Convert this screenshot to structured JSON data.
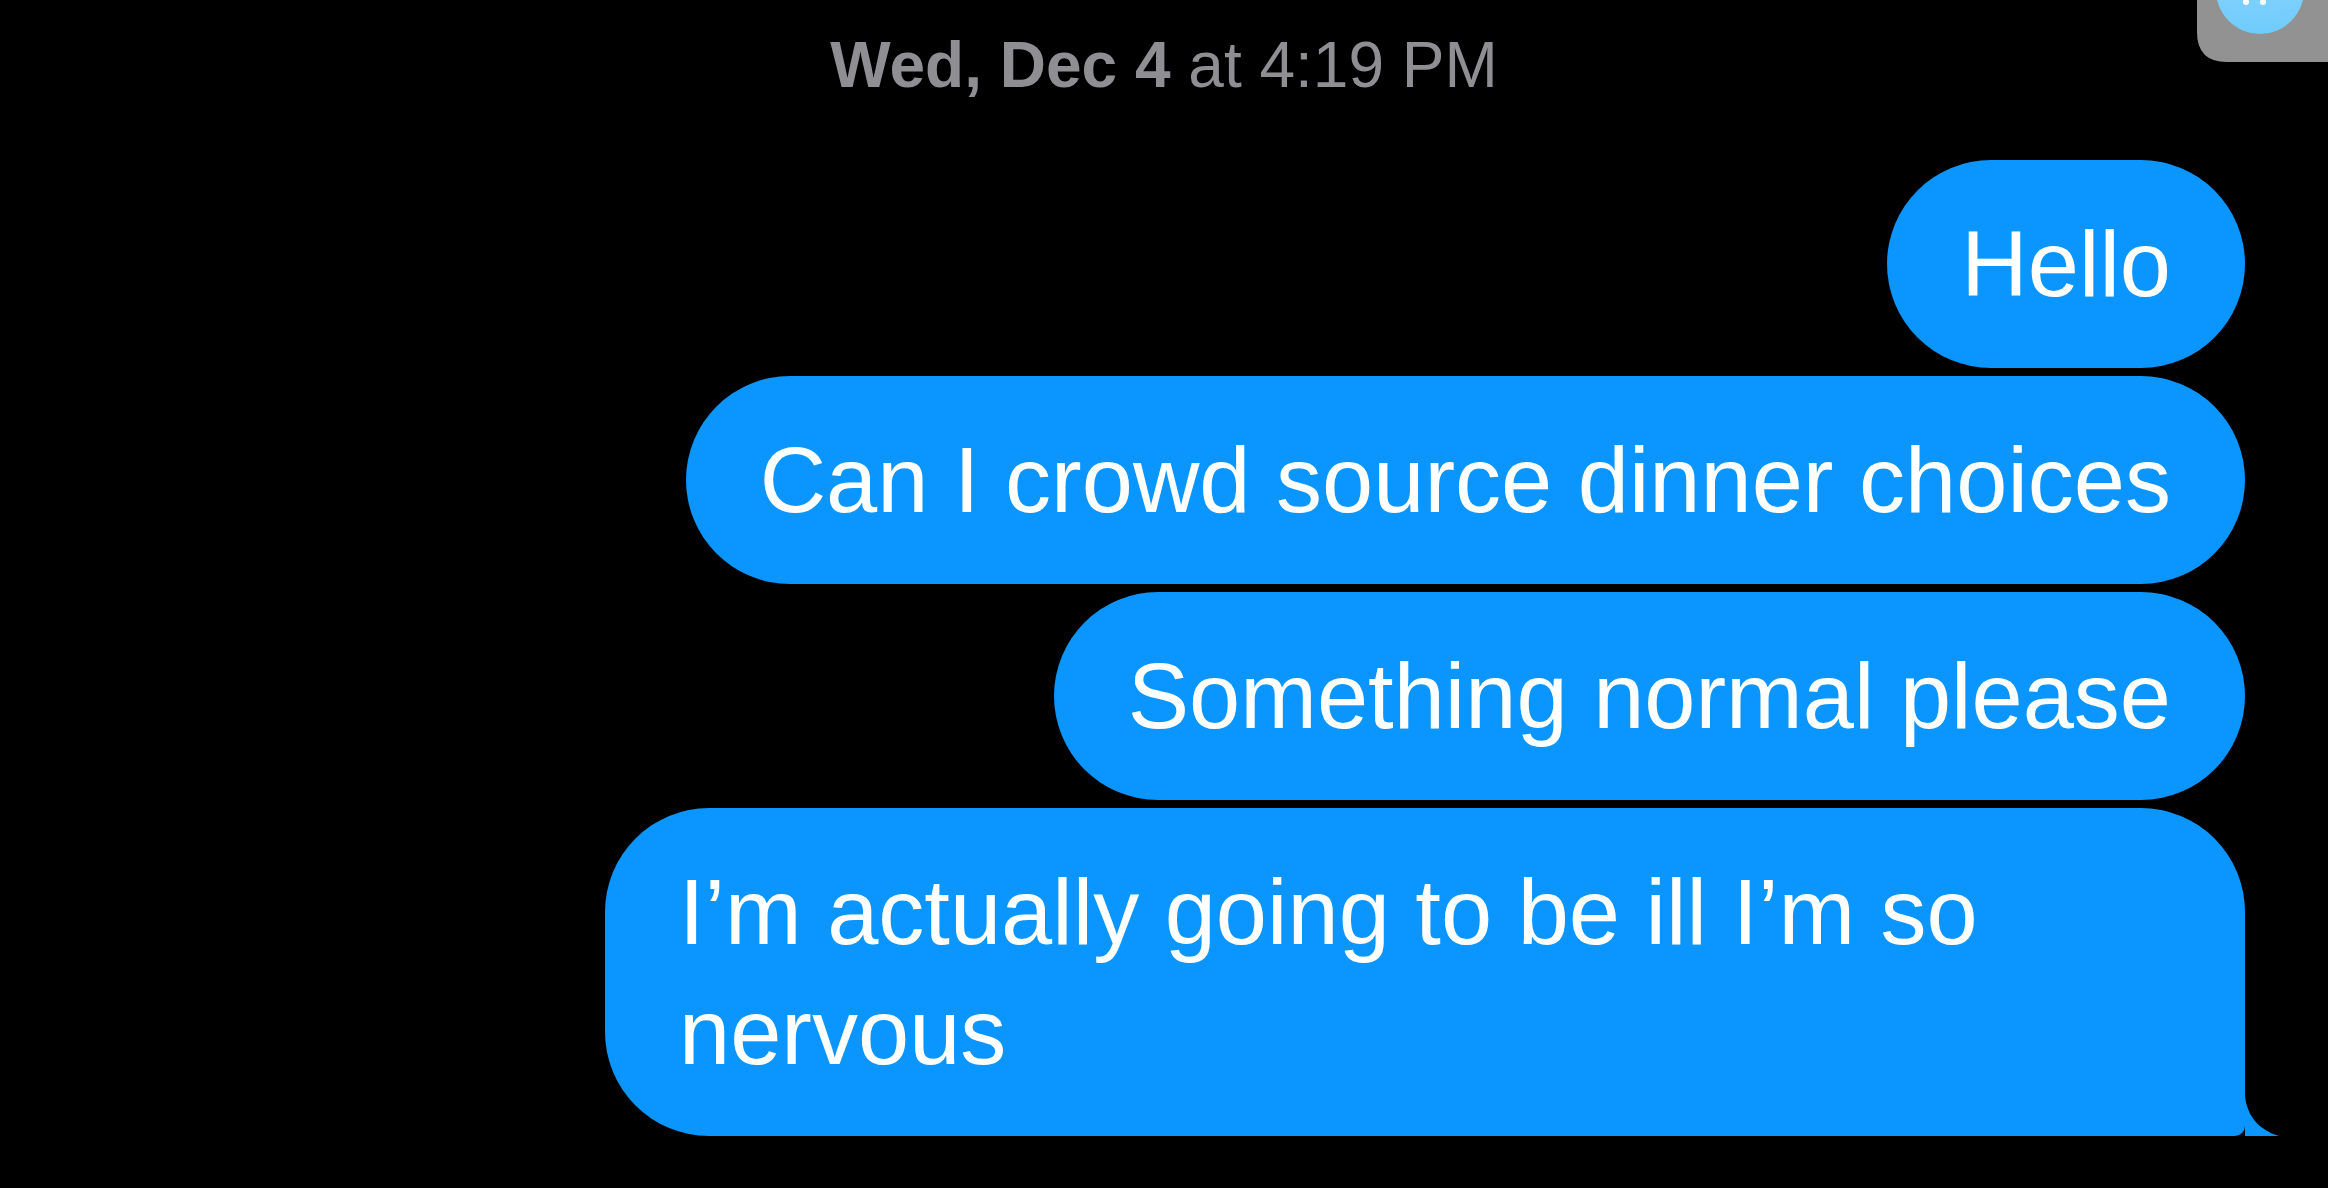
{
  "timestamp": "**Wed, Dec 4** at 4:19 PM",
  "messages": [
    {
      "text": "Hello",
      "kind": "sent",
      "tail": false
    },
    {
      "text": "Can I crowd source dinner choices",
      "kind": "sent",
      "tail": false
    },
    {
      "text": "Something normal please",
      "kind": "sent",
      "tail": false
    },
    {
      "text": "I’m actually going to be ill I’m so nervous",
      "kind": "sent",
      "tail": true
    }
  ]
}
